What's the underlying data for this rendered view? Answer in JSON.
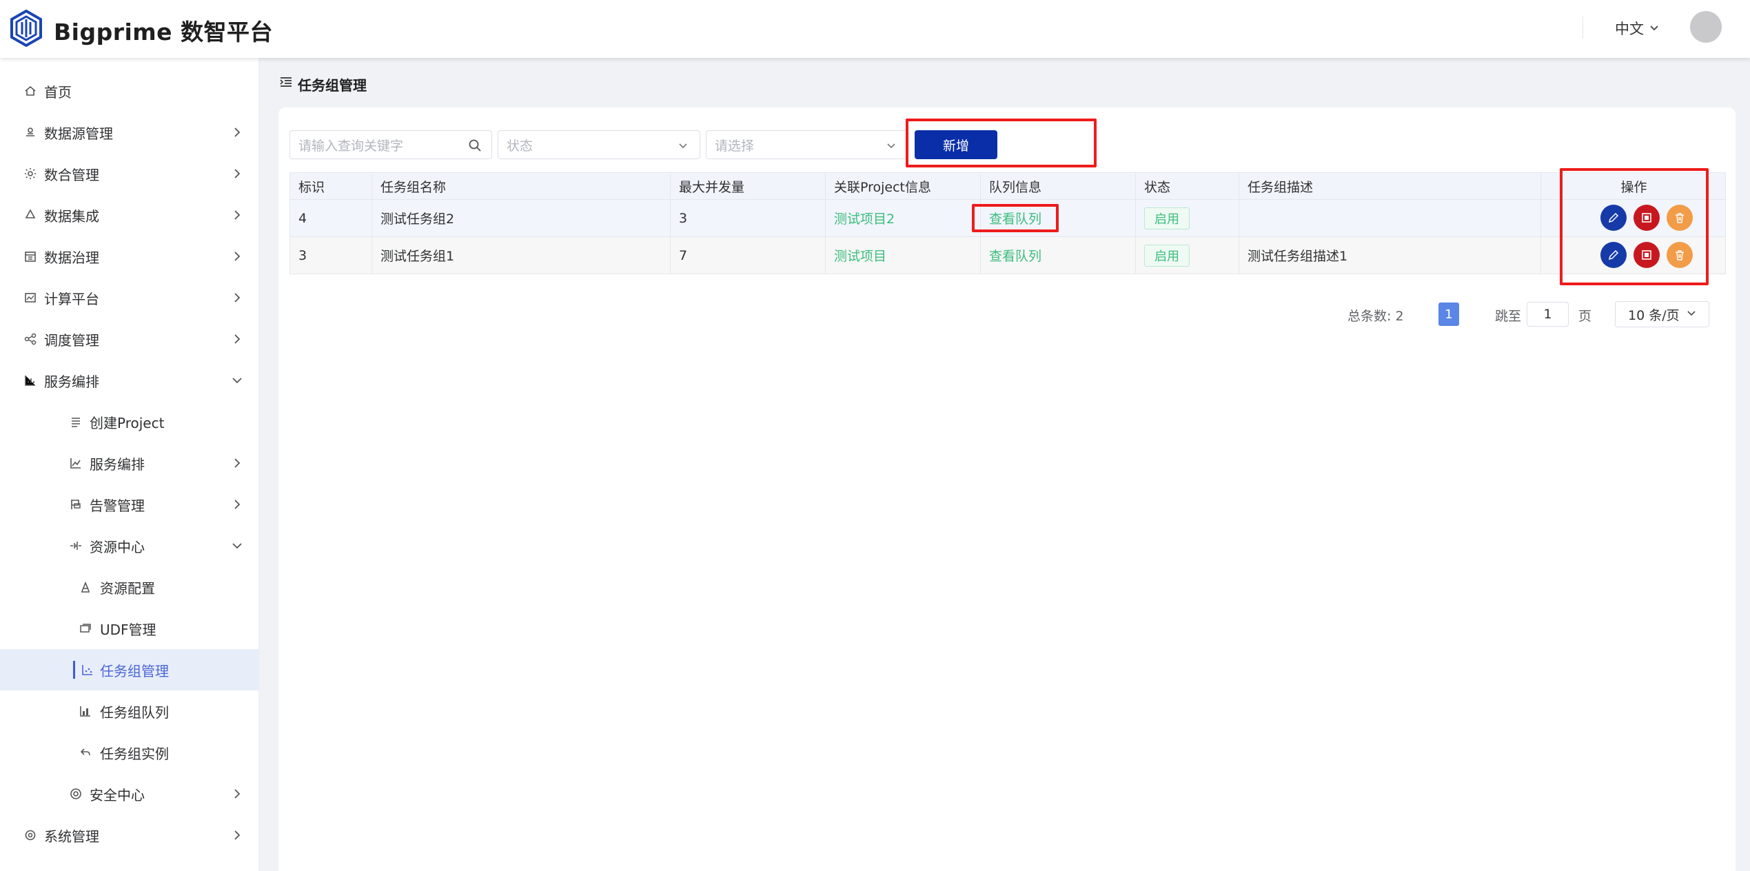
{
  "header": {
    "brand": "Bigprime 数智平台",
    "language": "中文"
  },
  "sidebar": {
    "items": [
      {
        "label": "首页",
        "icon": "home-icon"
      },
      {
        "label": "数据源管理",
        "icon": "datasource-icon"
      },
      {
        "label": "数合管理",
        "icon": "sun-icon"
      },
      {
        "label": "数据集成",
        "icon": "recycle-icon"
      },
      {
        "label": "数据治理",
        "icon": "calendar-icon"
      },
      {
        "label": "计算平台",
        "icon": "chart-window-icon"
      },
      {
        "label": "调度管理",
        "icon": "share-icon"
      },
      {
        "label": "服务编排",
        "icon": "bar-chart-icon"
      },
      {
        "label": "创建Project",
        "icon": "list-icon"
      },
      {
        "label": "服务编排",
        "icon": "line-chart-icon"
      },
      {
        "label": "告警管理",
        "icon": "flag-icon"
      },
      {
        "label": "资源中心",
        "icon": "pulse-icon"
      },
      {
        "label": "资源配置",
        "icon": "font-icon"
      },
      {
        "label": "UDF管理",
        "icon": "stack-icon"
      },
      {
        "label": "任务组管理",
        "icon": "scatter-icon"
      },
      {
        "label": "任务组队列",
        "icon": "bar-chart-filled-icon"
      },
      {
        "label": "任务组实例",
        "icon": "undo-icon"
      },
      {
        "label": "安全中心",
        "icon": "target-icon"
      },
      {
        "label": "系统管理",
        "icon": "gear-icon"
      }
    ]
  },
  "page": {
    "title": "任务组管理"
  },
  "filters": {
    "keyword_placeholder": "请输入查询关键字",
    "status_placeholder": "状态",
    "select_placeholder": "请选择",
    "add_label": "新增"
  },
  "table": {
    "headers": [
      "标识",
      "任务组名称",
      "最大并发量",
      "关联Project信息",
      "队列信息",
      "状态",
      "任务组描述",
      "操作"
    ],
    "rows": [
      {
        "id": "4",
        "name": "测试任务组2",
        "max": "3",
        "project": "测试项目2",
        "queue": "查看队列",
        "status": "启用",
        "desc": ""
      },
      {
        "id": "3",
        "name": "测试任务组1",
        "max": "7",
        "project": "测试项目",
        "queue": "查看队列",
        "status": "启用",
        "desc": "测试任务组描述1"
      }
    ]
  },
  "pagination": {
    "total": "总条数: 2",
    "current_page": "1",
    "goto_label": "跳至",
    "goto_value": "1",
    "page_unit": "页",
    "page_size": "10 条/页"
  },
  "colors": {
    "primary": "#0a2ea8",
    "highlight": "#ee1c1c",
    "link_green": "#3bbd7c",
    "active_nav": "#4a66d6"
  }
}
